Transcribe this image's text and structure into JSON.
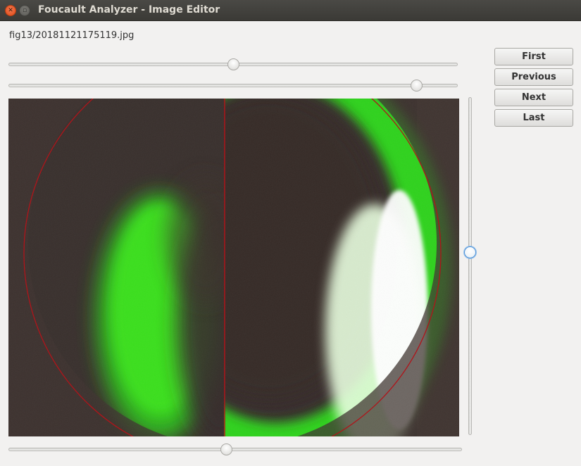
{
  "window": {
    "title": "Foucault Analyzer - Image Editor"
  },
  "image": {
    "filename": "fig13/20181121175119.jpg"
  },
  "sliders": {
    "top_1_value": 0.5,
    "top_2_value": 0.91,
    "vertical_value": 0.46,
    "bottom_value": 0.48
  },
  "nav": {
    "first_label": "First",
    "previous_label": "Previous",
    "next_label": "Next",
    "last_label": "Last"
  },
  "colors": {
    "overlay_line": "#b0141a",
    "glow": "#39ff1a",
    "accent": "#4a90d9"
  }
}
